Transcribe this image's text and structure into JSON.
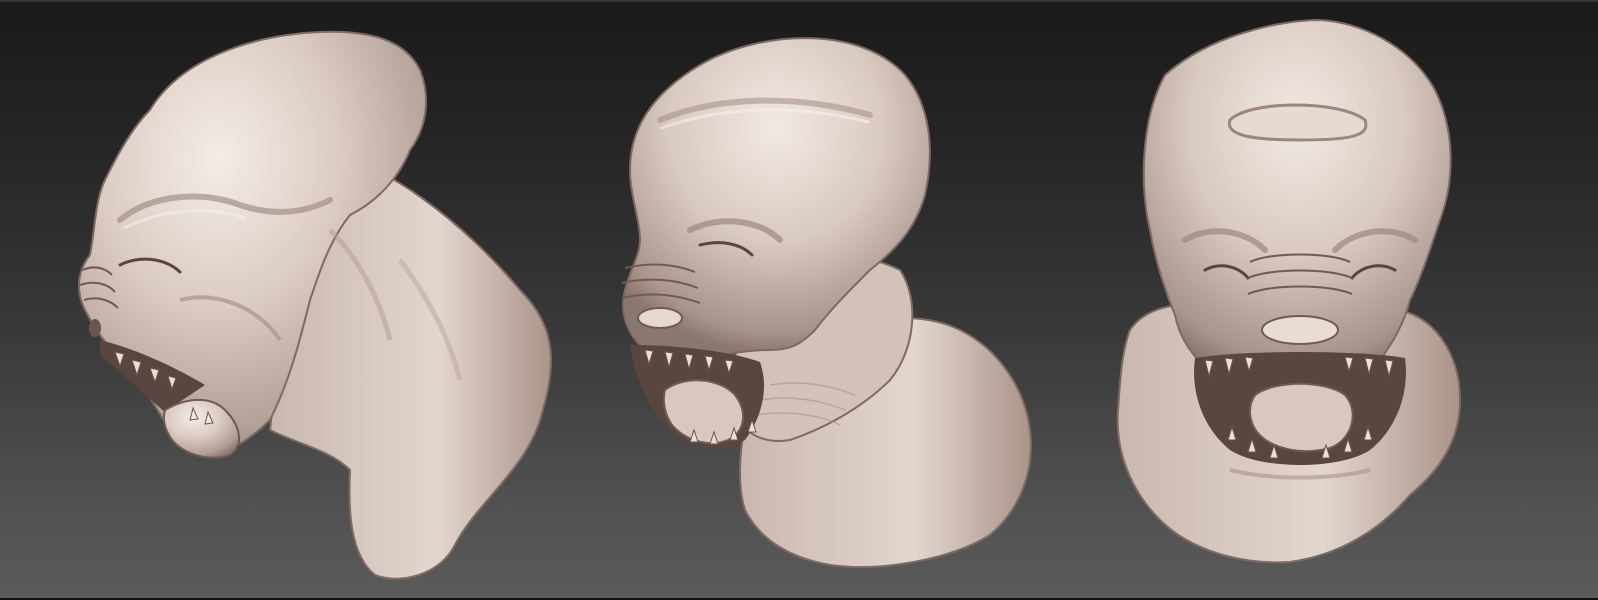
{
  "viewport": {
    "background_top": "#1a1a1a",
    "background_bottom": "#5b5b5b",
    "material_color": "#d9cac2",
    "material_shadow": "#8f7c74",
    "material_highlight": "#f4ece7",
    "cavity_color": "#5a4640"
  },
  "views": [
    {
      "name": "side-view",
      "icon": "sculpt-bust-side"
    },
    {
      "name": "three-quarter-view",
      "icon": "sculpt-bust-three-quarter"
    },
    {
      "name": "front-view",
      "icon": "sculpt-bust-front"
    }
  ]
}
